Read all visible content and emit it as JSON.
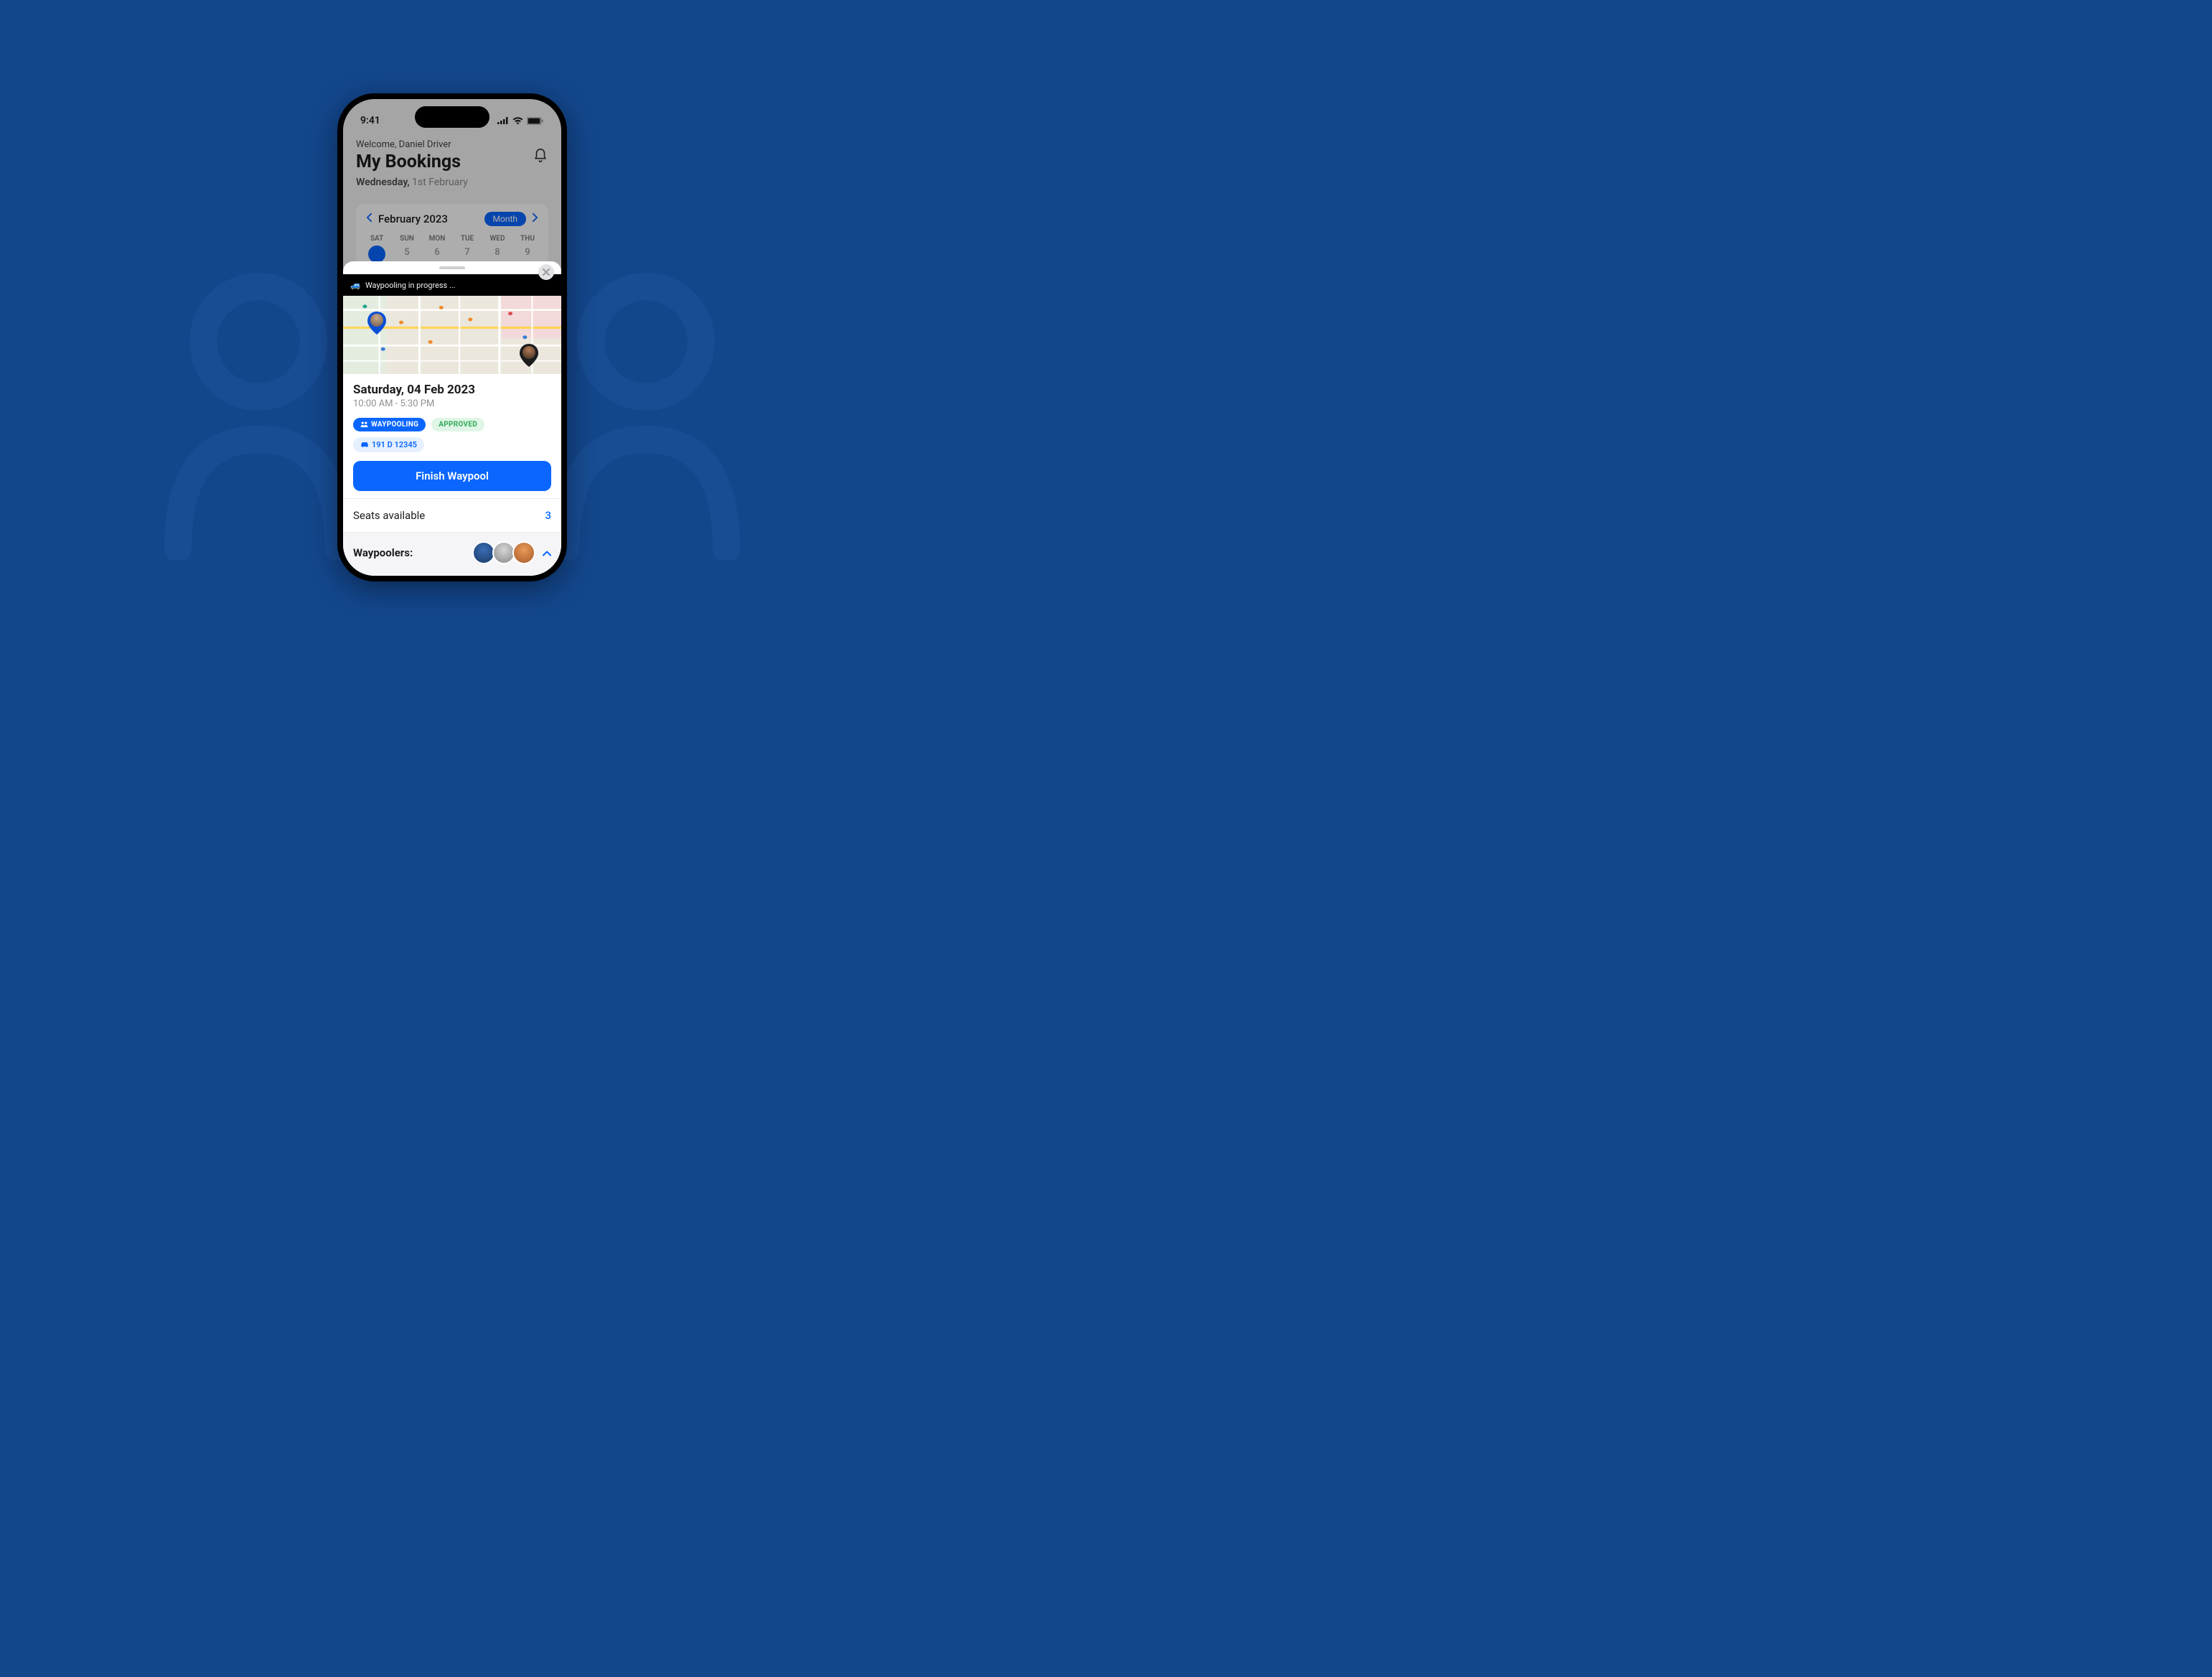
{
  "statusbar": {
    "time": "9:41"
  },
  "header": {
    "welcome": "Welcome, Daniel Driver",
    "title": "My Bookings",
    "date_bold": "Wednesday,",
    "date_rest": " 1st February"
  },
  "calendar": {
    "title": "February 2023",
    "view_label": "Month",
    "days": [
      {
        "dow": "SAT",
        "num": ""
      },
      {
        "dow": "SUN",
        "num": "5"
      },
      {
        "dow": "MON",
        "num": "6"
      },
      {
        "dow": "TUE",
        "num": "7"
      },
      {
        "dow": "WED",
        "num": "8"
      },
      {
        "dow": "THU",
        "num": "9"
      }
    ]
  },
  "sheet": {
    "progress_text": "Waypooling in progress ...",
    "date": "Saturday, 04 Feb 2023",
    "time": "10:00 AM - 5:30 PM",
    "pill_waypooling": "WAYPOOLING",
    "pill_approved": "APPROVED",
    "pill_plate": "191 D 12345",
    "primary_cta": "Finish Waypool",
    "seats_label": "Seats available",
    "seats_count": "3",
    "poolers_label": "Waypoolers:"
  }
}
